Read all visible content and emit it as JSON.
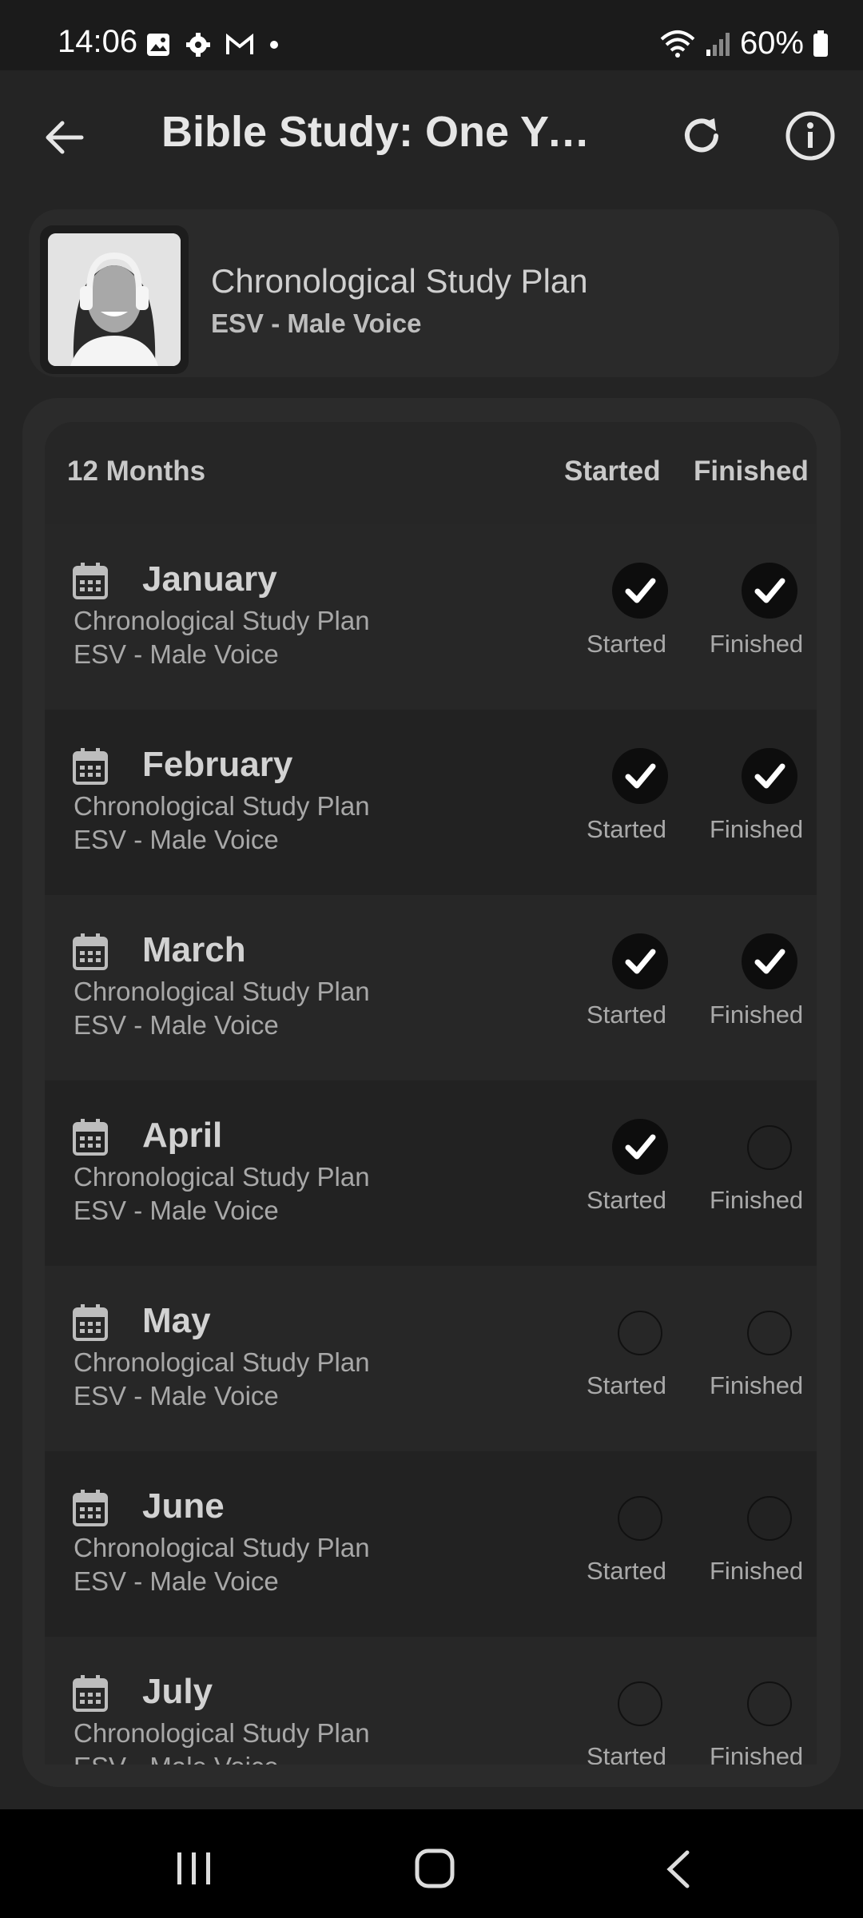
{
  "status_bar": {
    "time": "14:06",
    "battery": "60%"
  },
  "app_bar": {
    "title": "Bible Study: One Yea..."
  },
  "plan": {
    "title": "Chronological Study Plan",
    "subtitle": "ESV - Male Voice"
  },
  "list_header": {
    "count_label": "12 Months",
    "started_label": "Started",
    "finished_label": "Finished"
  },
  "months": [
    {
      "name": "January",
      "plan": "Chronological Study Plan",
      "voice": "ESV - Male Voice",
      "started": true,
      "finished": true,
      "started_label": "Started",
      "finished_label": "Finished"
    },
    {
      "name": "February",
      "plan": "Chronological Study Plan",
      "voice": "ESV - Male Voice",
      "started": true,
      "finished": true,
      "started_label": "Started",
      "finished_label": "Finished"
    },
    {
      "name": "March",
      "plan": "Chronological Study Plan",
      "voice": "ESV - Male Voice",
      "started": true,
      "finished": true,
      "started_label": "Started",
      "finished_label": "Finished"
    },
    {
      "name": "April",
      "plan": "Chronological Study Plan",
      "voice": "ESV - Male Voice",
      "started": true,
      "finished": false,
      "started_label": "Started",
      "finished_label": "Finished"
    },
    {
      "name": "May",
      "plan": "Chronological Study Plan",
      "voice": "ESV - Male Voice",
      "started": false,
      "finished": false,
      "started_label": "Started",
      "finished_label": "Finished"
    },
    {
      "name": "June",
      "plan": "Chronological Study Plan",
      "voice": "ESV - Male Voice",
      "started": false,
      "finished": false,
      "started_label": "Started",
      "finished_label": "Finished"
    },
    {
      "name": "July",
      "plan": "Chronological Study Plan",
      "voice": "ESV - Male Voice",
      "started": false,
      "finished": false,
      "started_label": "Started",
      "finished_label": "Finished"
    }
  ],
  "icons": {
    "back": "arrow-left-icon",
    "refresh": "refresh-icon",
    "info": "info-icon",
    "calendar": "calendar-icon",
    "check": "checkmark-icon"
  }
}
